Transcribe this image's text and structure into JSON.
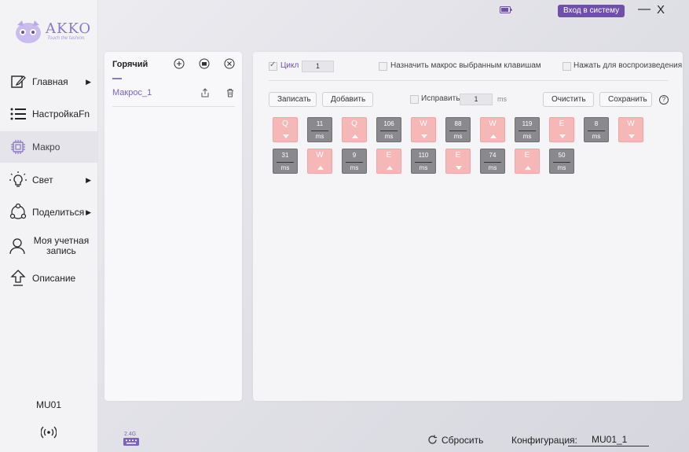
{
  "logo": {
    "brand": "AKKO",
    "tagline": "Touch the fashion."
  },
  "topbar": {
    "login_label": "Вход в систему",
    "minimize_label": "—",
    "close_label": "X"
  },
  "sidebar": {
    "items": [
      {
        "label": "Главная",
        "icon": "edit-icon",
        "has_arrow": true
      },
      {
        "label": "НастройкаFn",
        "icon": "list-icon",
        "has_arrow": false
      },
      {
        "label": "Макро",
        "icon": "chip-icon",
        "has_arrow": false,
        "active": true
      },
      {
        "label": "Свет",
        "icon": "bulb-icon",
        "has_arrow": true
      },
      {
        "label": "Поделиться",
        "icon": "share-icon",
        "has_arrow": true
      },
      {
        "label": "Моя учетная запись",
        "icon": "user-icon",
        "has_arrow": false
      },
      {
        "label": "Описание",
        "icon": "upload-icon",
        "has_arrow": false
      }
    ],
    "device_name": "MU01"
  },
  "macro_list": {
    "title": "Горячий",
    "items": [
      {
        "label": "Макрос_1"
      }
    ]
  },
  "macro_editor": {
    "cycle_label": "Цикл",
    "cycle_value": "1",
    "cycle_checked": true,
    "assign_label": "Назначить макрос выбранным клавишам",
    "press_play_label": "Нажать для воспроизведения",
    "record_label": "Записать",
    "add_label": "Добавить",
    "fix_label": "Исправить",
    "fix_value": "1",
    "fix_unit": "ms",
    "clear_label": "Очистить",
    "save_label": "Сохранить",
    "help_label": "?",
    "steps": [
      {
        "type": "key",
        "key": "Q",
        "dir": "down"
      },
      {
        "type": "delay",
        "value": "11",
        "unit": "ms"
      },
      {
        "type": "key",
        "key": "Q",
        "dir": "up"
      },
      {
        "type": "delay",
        "value": "106",
        "unit": "ms"
      },
      {
        "type": "key",
        "key": "W",
        "dir": "down"
      },
      {
        "type": "delay",
        "value": "88",
        "unit": "ms"
      },
      {
        "type": "key",
        "key": "W",
        "dir": "up"
      },
      {
        "type": "delay",
        "value": "119",
        "unit": "ms"
      },
      {
        "type": "key",
        "key": "E",
        "dir": "down"
      },
      {
        "type": "delay",
        "value": "8",
        "unit": "ms"
      },
      {
        "type": "key",
        "key": "W",
        "dir": "down"
      },
      {
        "type": "delay",
        "value": "31",
        "unit": "ms"
      },
      {
        "type": "key",
        "key": "W",
        "dir": "up"
      },
      {
        "type": "delay",
        "value": "9",
        "unit": "ms"
      },
      {
        "type": "key",
        "key": "E",
        "dir": "up"
      },
      {
        "type": "delay",
        "value": "110",
        "unit": "ms"
      },
      {
        "type": "key",
        "key": "E",
        "dir": "down"
      },
      {
        "type": "delay",
        "value": "74",
        "unit": "ms"
      },
      {
        "type": "key",
        "key": "E",
        "dir": "up"
      },
      {
        "type": "delay",
        "value": "50",
        "unit": "ms"
      }
    ]
  },
  "footer": {
    "connection_label": "2.4G",
    "reset_label": "Сбросить",
    "config_label": "Конфигурация:",
    "config_value": "MU01_1"
  },
  "colors": {
    "accent": "#6f4fa8",
    "key_block": "#f6b7b7",
    "delay_block": "#8a8a8e"
  }
}
